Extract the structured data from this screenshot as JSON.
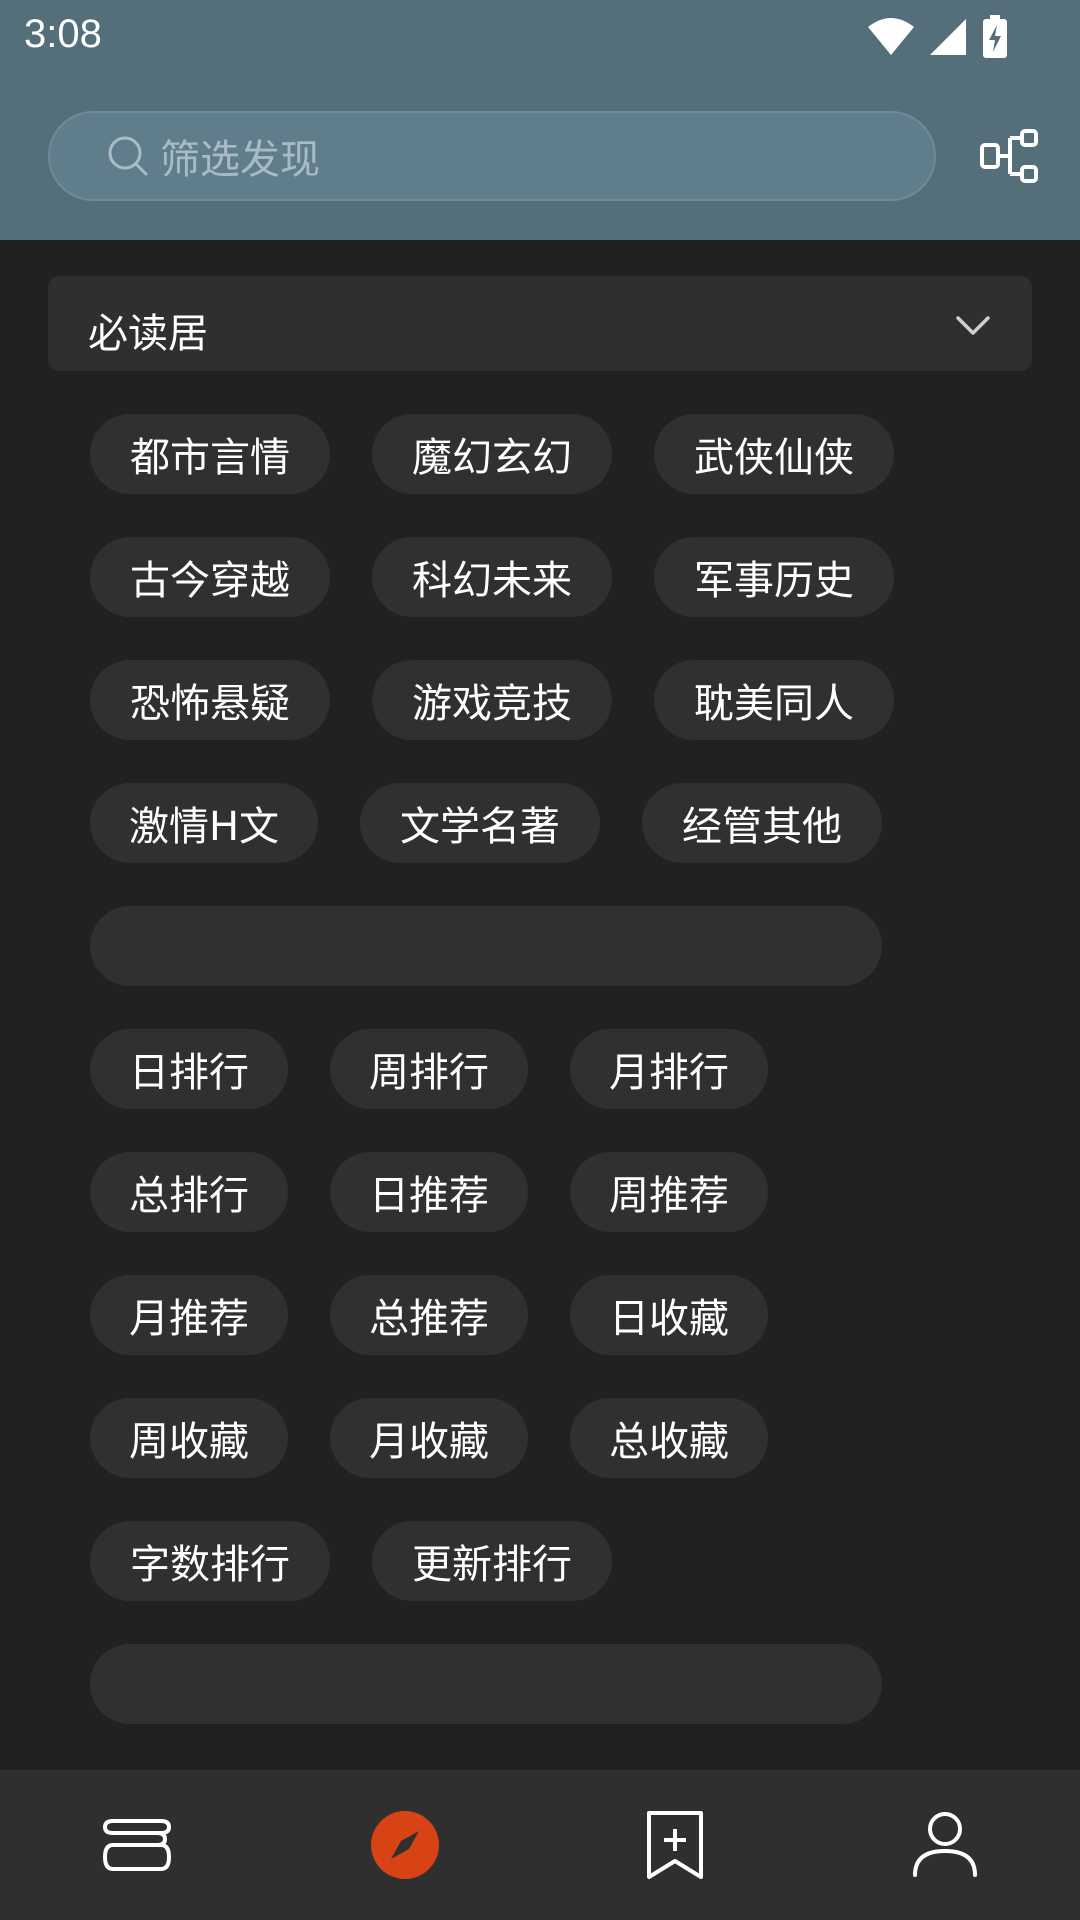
{
  "status_bar": {
    "time": "3:08",
    "icons": [
      "wifi-icon",
      "signal-icon",
      "battery-charging-icon"
    ]
  },
  "search": {
    "placeholder": "筛选发现"
  },
  "source": {
    "selected": "必读居"
  },
  "chips": {
    "row1": [
      "都市言情",
      "魔幻玄幻",
      "武侠仙侠"
    ],
    "row2": [
      "古今穿越",
      "科幻未来",
      "军事历史"
    ],
    "row3": [
      "恐怖悬疑",
      "游戏竞技",
      "耽美同人"
    ],
    "row4": [
      "激情H文",
      "文学名著",
      "经管其他"
    ],
    "row6": [
      "日排行",
      "周排行",
      "月排行"
    ],
    "row7": [
      "总排行",
      "日推荐",
      "周推荐"
    ],
    "row8": [
      "月推荐",
      "总推荐",
      "日收藏"
    ],
    "row9": [
      "周收藏",
      "月收藏",
      "总收藏"
    ],
    "row10": [
      "字数排行",
      "更新排行"
    ]
  },
  "bottom_nav": {
    "items": [
      "bookshelf-icon",
      "compass-icon",
      "bookmark-add-icon",
      "person-icon"
    ],
    "active_color": "#d84315"
  },
  "colors": {
    "header": "#546e7a",
    "background": "#212121",
    "chip": "#303030"
  }
}
